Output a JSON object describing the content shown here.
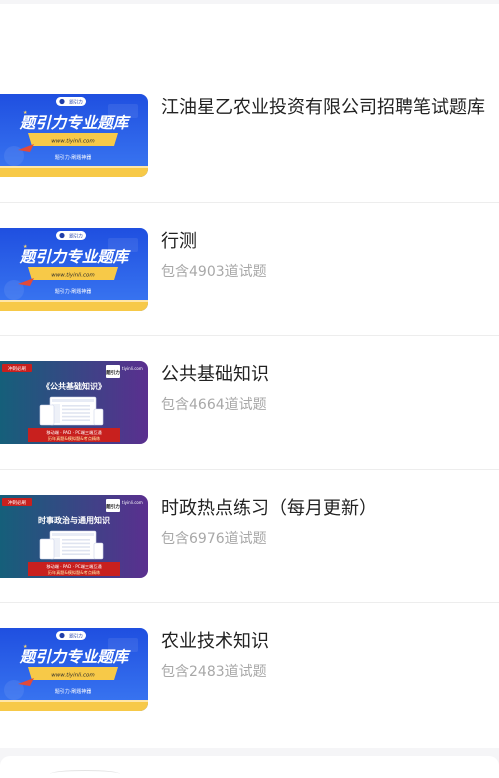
{
  "items": [
    {
      "title": "江油星乙农业投资有限公司招聘笔试题库",
      "count": "",
      "thumb": {
        "type": "blue",
        "brand": "题引力专业题库",
        "url": "www.tiyinli.com",
        "footer": "题引力·刷题神器",
        "tag": "题引力"
      }
    },
    {
      "title": "行测",
      "count": "包含4903道试题",
      "thumb": {
        "type": "blue",
        "brand": "题引力专业题库",
        "url": "www.tiyinli.com",
        "footer": "题引力·刷题神器",
        "tag": "题引力"
      }
    },
    {
      "title": "公共基础知识",
      "count": "包含4664道试题",
      "thumb": {
        "type": "purple",
        "tag": "冲刺必刷",
        "heading": "《公共基础知识》",
        "site": "tiyinli.com",
        "logo": "题引力",
        "footer1": "移动端 · PAD · PC端三端互通",
        "footer2": "历年真题&模拟题&考点精练"
      }
    },
    {
      "title": "时政热点练习（每月更新）",
      "count": "包含6976道试题",
      "thumb": {
        "type": "purple",
        "tag": "冲刺必刷",
        "heading": "时事政治与通用知识",
        "site": "tiyinli.com",
        "logo": "题引力",
        "footer1": "移动端 · PAD · PC端三端互通",
        "footer2": "历年真题&模拟题&考点精练"
      }
    },
    {
      "title": "农业技术知识",
      "count": "包含2483道试题",
      "thumb": {
        "type": "blue",
        "brand": "题引力专业题库",
        "url": "www.tiyinli.com",
        "footer": "题引力·刷题神器",
        "tag": "题引力"
      }
    }
  ],
  "colors": {
    "blue_top": "#1f4fe0",
    "blue_bottom": "#3b78f2",
    "ribbon": "#f7c948",
    "purple_left": "#155f7a",
    "purple_right": "#5a2f8f",
    "red": "#c8201e"
  }
}
